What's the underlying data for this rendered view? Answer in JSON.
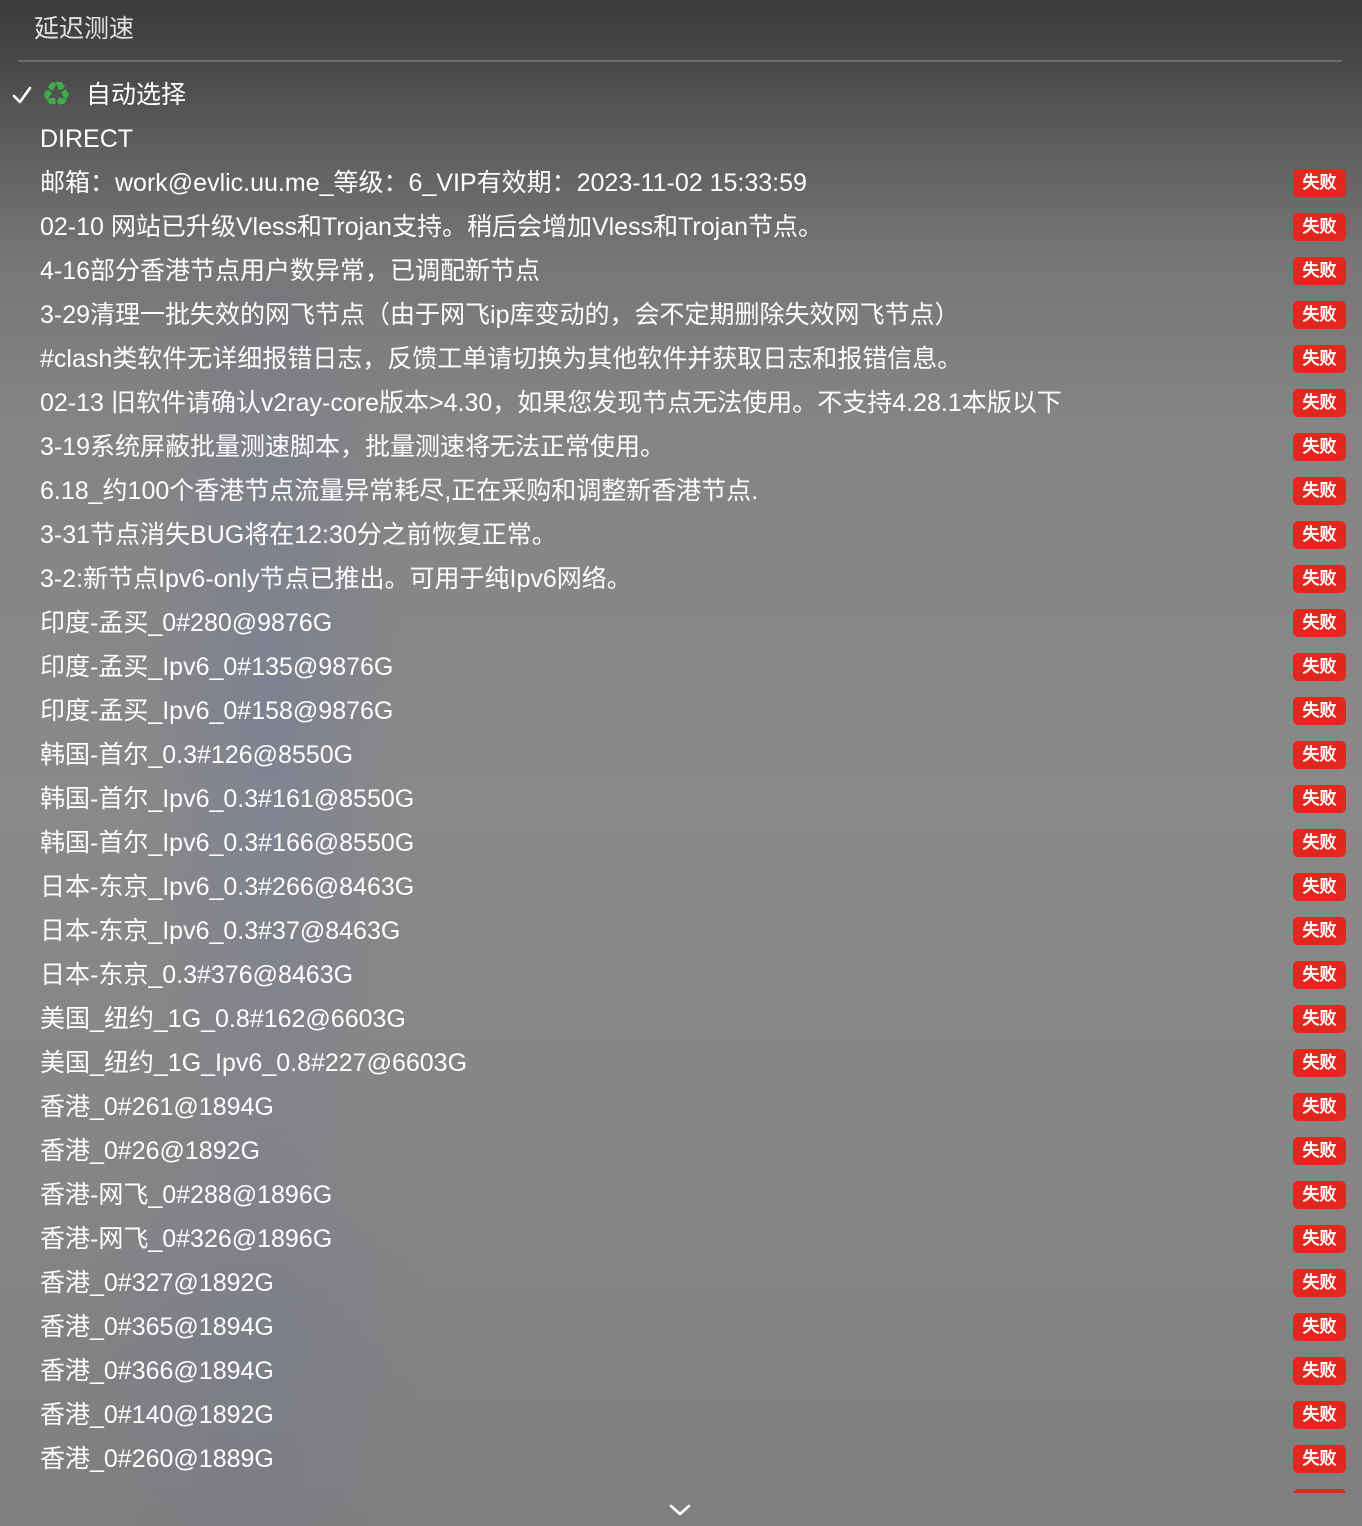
{
  "menu": {
    "speed_test": {
      "label": "延迟测速"
    },
    "auto_select": {
      "label": "自动选择",
      "icon": "recycle-icon",
      "check_icon": "checkmark-icon",
      "selected": true
    },
    "direct": {
      "label": "DIRECT"
    },
    "items": [
      {
        "label": "邮箱：work@evlic.uu.me_等级：6_VIP有效期：2023-11-02 15:33:59",
        "status": "失败"
      },
      {
        "label": "02-10 网站已升级Vless和Trojan支持。稍后会增加Vless和Trojan节点。",
        "status": "失败"
      },
      {
        "label": "4-16部分香港节点用户数异常，已调配新节点",
        "status": "失败"
      },
      {
        "label": "3-29清理一批失效的网飞节点（由于网飞ip库变动的，会不定期删除失效网飞节点）",
        "status": "失败"
      },
      {
        "label": "#clash类软件无详细报错日志，反馈工单请切换为其他软件并获取日志和报错信息。",
        "status": "失败"
      },
      {
        "label": "02-13 旧软件请确认v2ray-core版本>4.30，如果您发现节点无法使用。不支持4.28.1本版以下",
        "status": "失败"
      },
      {
        "label": "3-19系统屏蔽批量测速脚本，批量测速将无法正常使用。",
        "status": "失败"
      },
      {
        "label": "6.18_约100个香港节点流量异常耗尽,正在采购和调整新香港节点.",
        "status": "失败"
      },
      {
        "label": "3-31节点消失BUG将在12:30分之前恢复正常。",
        "status": "失败"
      },
      {
        "label": "3-2:新节点Ipv6-only节点已推出。可用于纯Ipv6网络。",
        "status": "失败"
      },
      {
        "label": "印度-孟买_0#280@9876G",
        "status": "失败"
      },
      {
        "label": "印度-孟买_Ipv6_0#135@9876G",
        "status": "失败"
      },
      {
        "label": "印度-孟买_Ipv6_0#158@9876G",
        "status": "失败"
      },
      {
        "label": "韩国-首尔_0.3#126@8550G",
        "status": "失败"
      },
      {
        "label": "韩国-首尔_Ipv6_0.3#161@8550G",
        "status": "失败"
      },
      {
        "label": "韩国-首尔_Ipv6_0.3#166@8550G",
        "status": "失败"
      },
      {
        "label": "日本-东京_Ipv6_0.3#266@8463G",
        "status": "失败"
      },
      {
        "label": "日本-东京_Ipv6_0.3#37@8463G",
        "status": "失败"
      },
      {
        "label": "日本-东京_0.3#376@8463G",
        "status": "失败"
      },
      {
        "label": "美国_纽约_1G_0.8#162@6603G",
        "status": "失败"
      },
      {
        "label": "美国_纽约_1G_Ipv6_0.8#227@6603G",
        "status": "失败"
      },
      {
        "label": "香港_0#261@1894G",
        "status": "失败"
      },
      {
        "label": "香港_0#26@1892G",
        "status": "失败"
      },
      {
        "label": "香港-网飞_0#288@1896G",
        "status": "失败"
      },
      {
        "label": "香港-网飞_0#326@1896G",
        "status": "失败"
      },
      {
        "label": "香港_0#327@1892G",
        "status": "失败"
      },
      {
        "label": "香港_0#365@1894G",
        "status": "失败"
      },
      {
        "label": "香港_0#366@1894G",
        "status": "失败"
      },
      {
        "label": "香港_0#140@1892G",
        "status": "失败"
      },
      {
        "label": "香港_0#260@1889G",
        "status": "失败"
      }
    ],
    "scroll_indicator_icon": "chevron-down-icon"
  },
  "colors": {
    "status_fail": "#e2281e",
    "recycle_icon": "#3fae49",
    "text": "#ffffff"
  }
}
